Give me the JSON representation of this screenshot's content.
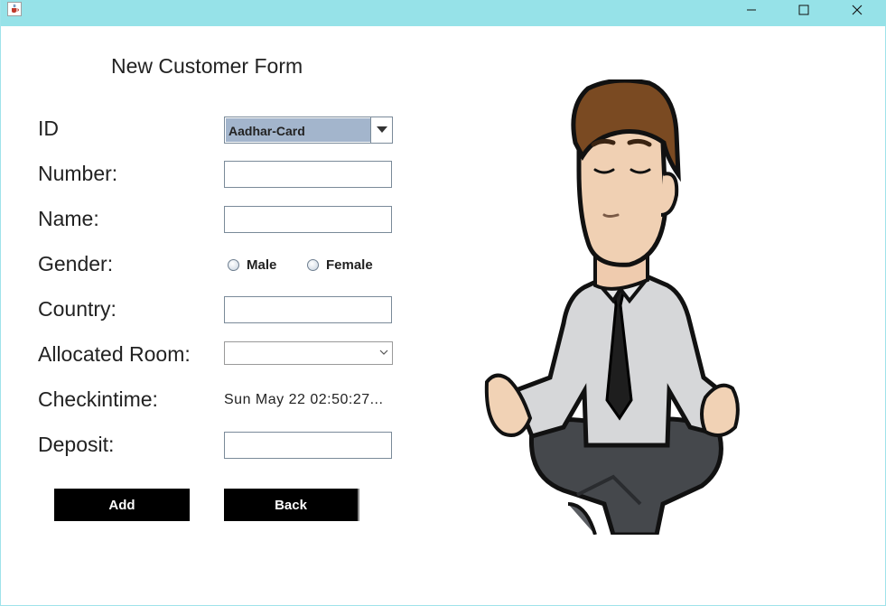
{
  "form": {
    "title": "New Customer Form",
    "labels": {
      "id": "ID",
      "number": "Number:",
      "name": "Name:",
      "gender": "Gender:",
      "country": "Country:",
      "room": "Allocated Room:",
      "checkin": "Checkintime:",
      "deposit": "Deposit:"
    },
    "id_select": {
      "selected": "Aadhar-Card"
    },
    "number_value": "",
    "name_value": "",
    "country_value": "",
    "room_select": {
      "selected": ""
    },
    "deposit_value": "",
    "gender_options": {
      "male": "Male",
      "female": "Female"
    },
    "checkin_value": "Sun May 22 02:50:27..."
  },
  "buttons": {
    "add": "Add",
    "back": "Back"
  },
  "colors": {
    "titlebar": "#96e2e8",
    "selected_highlight": "#a3b5cc",
    "button_bg": "#000000",
    "button_text": "#ffffff"
  },
  "icons": {
    "app": "java-cup-icon",
    "minimize": "minimize-icon",
    "maximize": "maximize-icon",
    "close": "close-icon",
    "dropdown": "caret-down-icon"
  }
}
